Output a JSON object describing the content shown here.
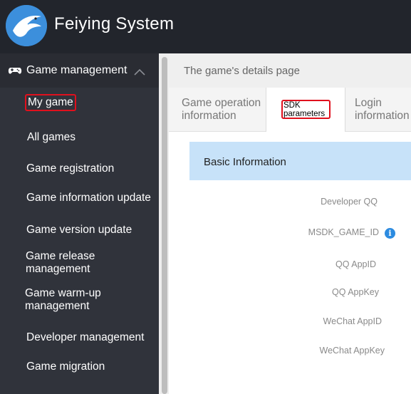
{
  "app": {
    "title": "Feiying System"
  },
  "sidebar": {
    "section_label": "Game management",
    "items": [
      {
        "label": "My game"
      },
      {
        "label": "All games"
      },
      {
        "label": "Game registration"
      },
      {
        "label": "Game information update"
      },
      {
        "label": "Game version update"
      },
      {
        "label": "Game release management"
      },
      {
        "label": "Game warm-up management"
      },
      {
        "label": "Developer management"
      },
      {
        "label": "Game migration"
      }
    ]
  },
  "page": {
    "title": "The game's details page",
    "tabs": [
      {
        "label": "Game operation information"
      },
      {
        "label": "SDK parameters"
      },
      {
        "label": "Login information"
      }
    ],
    "section_title": "Basic Information",
    "fields": [
      {
        "label": "Developer QQ"
      },
      {
        "label": "MSDK_GAME_ID"
      },
      {
        "label": "QQ AppID"
      },
      {
        "label": "QQ AppKey"
      },
      {
        "label": "WeChat AppID"
      },
      {
        "label": "WeChat AppKey"
      }
    ]
  },
  "colors": {
    "topbar": "#22252c",
    "sidebar": "#30333b",
    "highlight": "#e0101d",
    "section_band": "#c7e2f9",
    "accent": "#2c8be0"
  },
  "icons": {
    "logo": "eagle-logo-icon",
    "section": "gamepad-icon",
    "collapse": "chevron-up-icon",
    "info": "info-icon"
  }
}
